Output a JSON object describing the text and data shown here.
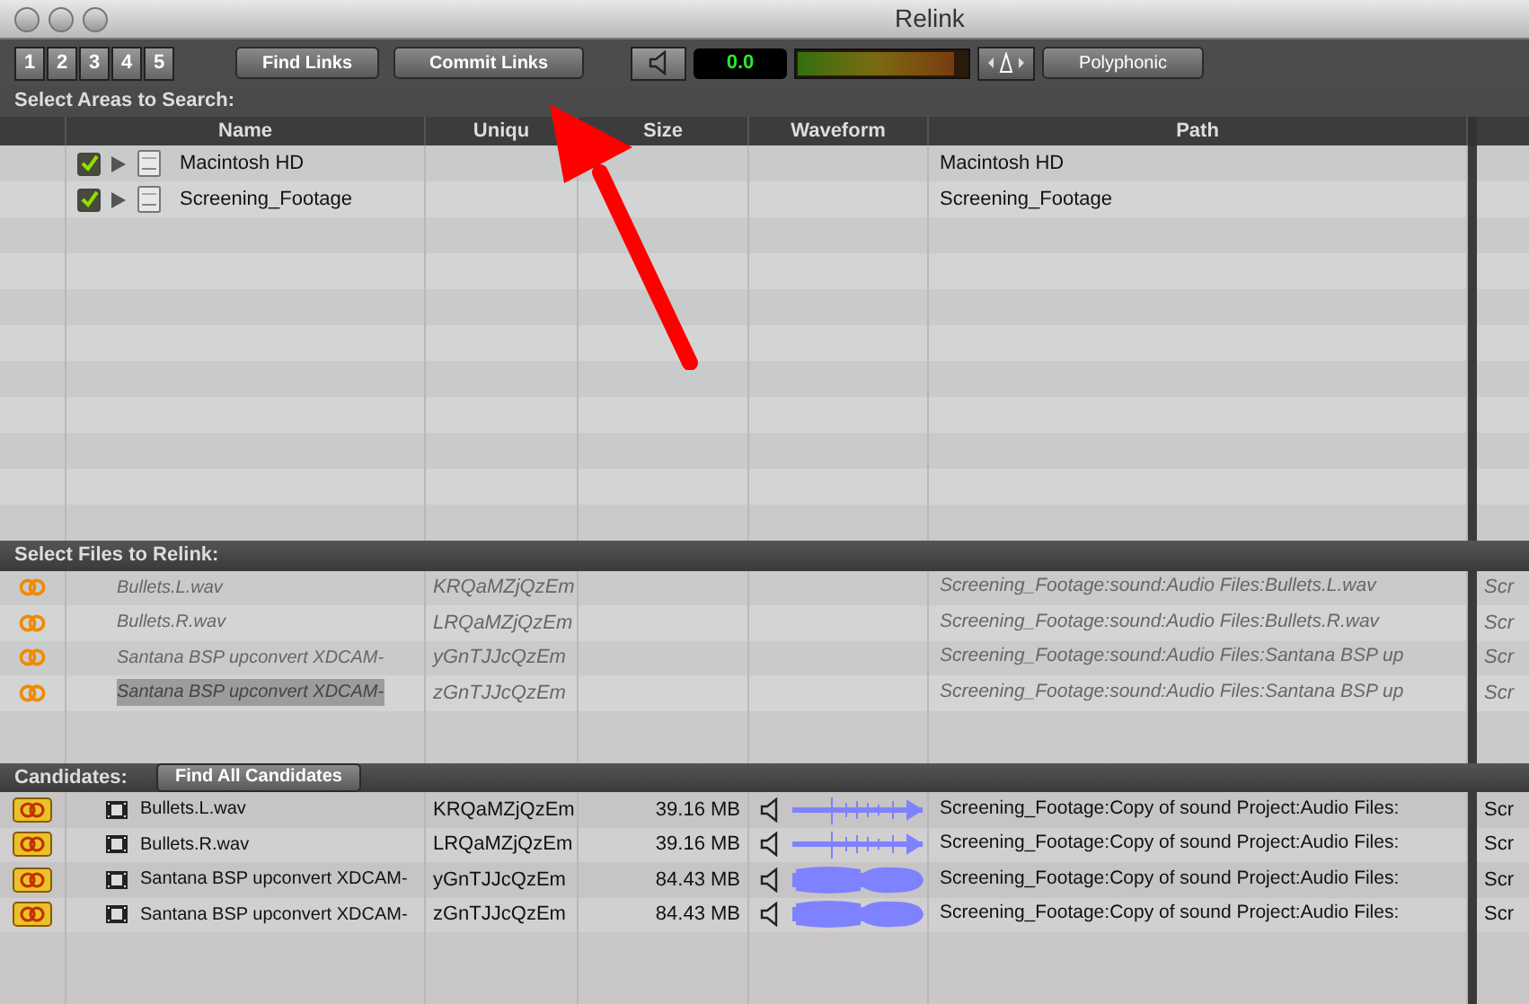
{
  "window": {
    "title": "Relink"
  },
  "toolbar": {
    "tracks": [
      {
        "label": "1",
        "selected": true
      },
      {
        "label": "2",
        "selected": true
      },
      {
        "label": "3",
        "selected": true
      },
      {
        "label": "4",
        "selected": true
      },
      {
        "label": "5",
        "selected": true
      }
    ],
    "find_links": "Find Links",
    "commit_links": "Commit Links",
    "volume": "0.0",
    "meter": {
      "level": 0.93
    },
    "mode": "Polyphonic"
  },
  "areas": {
    "label": "Select Areas to Search:",
    "columns": [
      "Name",
      "Uniqu",
      "Size",
      "Waveform",
      "Path"
    ],
    "rows": [
      {
        "name": "Macintosh HD",
        "path": "Macintosh HD",
        "checked": true
      },
      {
        "name": "Screening_Footage",
        "path": "Screening_Footage",
        "checked": true
      }
    ]
  },
  "files": {
    "label": "Select Files to Relink:",
    "rows": [
      {
        "name": "Bullets.L.wav",
        "unique": "KRQaMZjQzEm",
        "path": "Screening_Footage:sound:Audio Files:Bullets.L.wav",
        "column_7": "Scr",
        "selected": false
      },
      {
        "name": "Bullets.R.wav",
        "unique": "LRQaMZjQzEm",
        "path": "Screening_Footage:sound:Audio Files:Bullets.R.wav",
        "column_7": "Scr",
        "selected": false
      },
      {
        "name": "Santana BSP upconvert XDCAM-",
        "unique": "yGnTJJcQzEm",
        "path": "Screening_Footage:sound:Audio Files:Santana BSP up",
        "column_7": "Scr",
        "selected": false
      },
      {
        "name": "Santana BSP upconvert XDCAM-",
        "unique": "zGnTJJcQzEm",
        "path": "Screening_Footage:sound:Audio Files:Santana BSP up",
        "column_7": "Scr",
        "selected": true
      }
    ]
  },
  "candidates": {
    "label": "Candidates:",
    "find_all": "Find All Candidates",
    "rows": [
      {
        "name": "Bullets.L.wav",
        "unique": "KRQaMZjQzEm",
        "size": "39.16 MB",
        "kind": "sparse",
        "path": "Screening_Footage:Copy of sound Project:Audio Files:",
        "column_7": "Scr"
      },
      {
        "name": "Bullets.R.wav",
        "unique": "LRQaMZjQzEm",
        "size": "39.16 MB",
        "kind": "sparse",
        "path": "Screening_Footage:Copy of sound Project:Audio Files:",
        "column_7": "Scr"
      },
      {
        "name": "Santana BSP upconvert XDCAM-",
        "unique": "yGnTJJcQzEm",
        "size": "84.43 MB",
        "kind": "dense",
        "path": "Screening_Footage:Copy of sound Project:Audio Files:",
        "column_7": "Scr"
      },
      {
        "name": "Santana BSP upconvert XDCAM-",
        "unique": "zGnTJJcQzEm",
        "size": "84.43 MB",
        "kind": "dense",
        "path": "Screening_Footage:Copy of sound Project:Audio Files:",
        "column_7": "Scr"
      }
    ]
  }
}
